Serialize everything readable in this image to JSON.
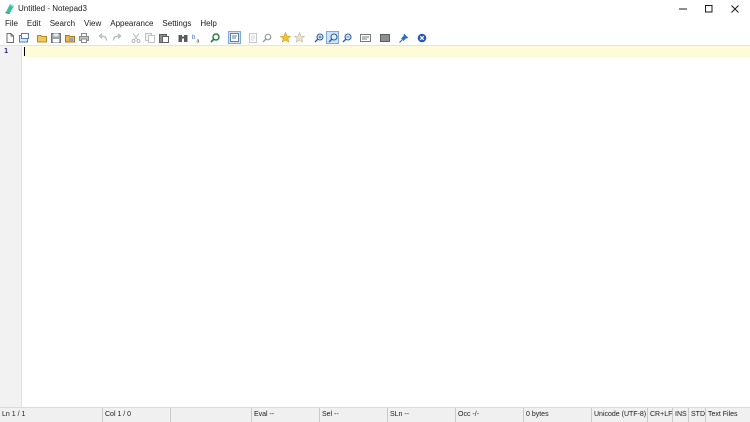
{
  "window": {
    "title": "Untitled - Notepad3"
  },
  "menu": [
    "File",
    "Edit",
    "Search",
    "View",
    "Appearance",
    "Settings",
    "Help"
  ],
  "toolbar": {
    "buttons": [
      "new-file-icon",
      "open-file-icon",
      "browse-folder-icon",
      "save-icon",
      "save-as-icon",
      "print-icon",
      "undo-icon",
      "redo-icon",
      "cut-icon",
      "copy-icon",
      "paste-icon",
      "find-icon",
      "replace-icon",
      "find-in-files-icon",
      "word-wrap-icon",
      "toggle-view-icon",
      "zoom-text-icon",
      "add-favorite-icon",
      "favorites-icon",
      "zoom-in-icon",
      "reset-zoom-icon",
      "zoom-out-icon",
      "schema-icon",
      "customize-icon",
      "pin-on-top-icon",
      "exit-icon"
    ],
    "active_button": "word-wrap-icon"
  },
  "editor": {
    "line_numbers": [
      "1"
    ],
    "content": "",
    "current_line_color": "#fefcd8"
  },
  "status": {
    "ln": "Ln  1 / 1",
    "col": "Col  1 / 0",
    "eval": "Eval  --",
    "sel": "Sel  --",
    "sln": "SLn  --",
    "occ": "Occ  -/-",
    "size": "0 bytes",
    "encoding": "Unicode (UTF-8)",
    "eol": "CR+LF",
    "ovr": "INS",
    "mode": "STD",
    "lexer": "Text Files"
  },
  "colors": {
    "accent": "#2d7dd2",
    "gutter_number": "#2b2b8a",
    "status_bg": "#f0f0f0"
  }
}
